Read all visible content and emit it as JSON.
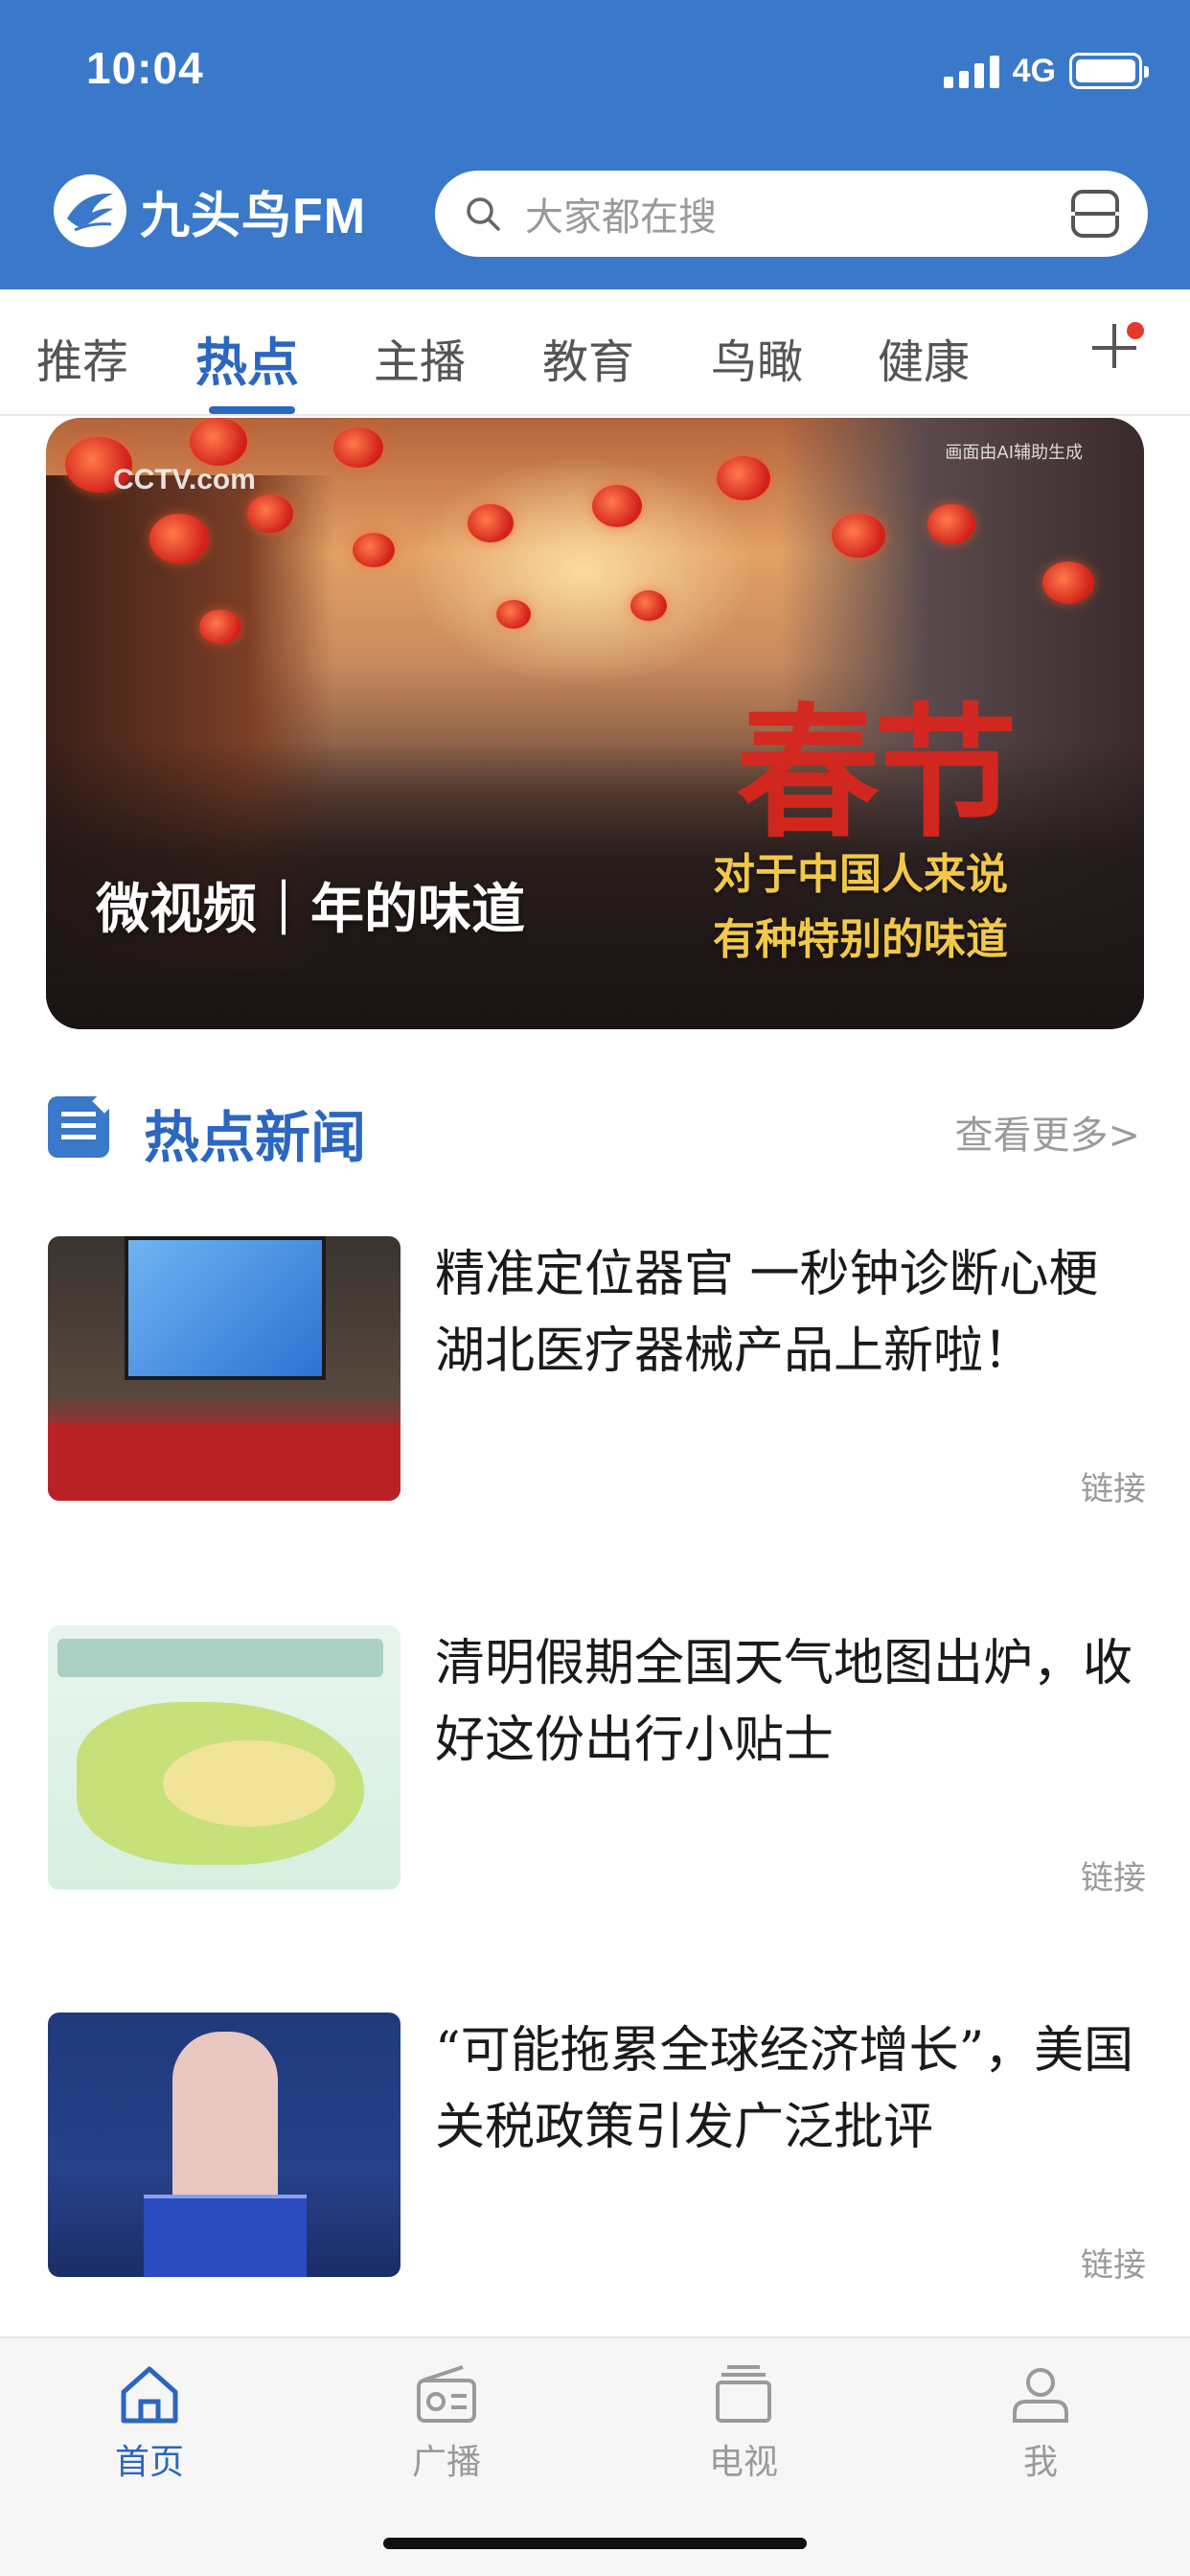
{
  "status": {
    "time": "10:04",
    "network": "4G"
  },
  "header": {
    "app_name": "九头鸟FM",
    "search_placeholder": "大家都在搜"
  },
  "tabs": [
    {
      "label": "推荐",
      "active": false
    },
    {
      "label": "热点",
      "active": true
    },
    {
      "label": "主播",
      "active": false
    },
    {
      "label": "教育",
      "active": false
    },
    {
      "label": "鸟瞰",
      "active": false
    },
    {
      "label": "健康",
      "active": false
    }
  ],
  "banner": {
    "caption": "微视频｜年的味道",
    "source_logo": "CCTV.com",
    "ai_note": "画面由AI辅助生成",
    "overlay_big": "春节",
    "overlay_line1": "对于中国人来说",
    "overlay_line2": "有种特别的味道"
  },
  "section": {
    "title": "热点新闻",
    "more": "查看更多>"
  },
  "news": [
    {
      "title": "精准定位器官 一秒钟诊断心梗 湖北医疗器械产品上新啦！",
      "tag": "链接"
    },
    {
      "title": "清明假期全国天气地图出炉，收好这份出行小贴士",
      "tag": "链接"
    },
    {
      "title": "“可能拖累全球经济增长”，美国关税政策引发广泛批评",
      "tag": "链接"
    }
  ],
  "bottom_nav": [
    {
      "label": "首页",
      "active": true,
      "icon": "home-icon"
    },
    {
      "label": "广播",
      "active": false,
      "icon": "radio-icon"
    },
    {
      "label": "电视",
      "active": false,
      "icon": "tv-icon"
    },
    {
      "label": "我",
      "active": false,
      "icon": "user-icon"
    }
  ],
  "colors": {
    "brand_blue": "#3a78c9",
    "active_blue": "#2b66c0",
    "badge_red": "#e23a2e"
  }
}
